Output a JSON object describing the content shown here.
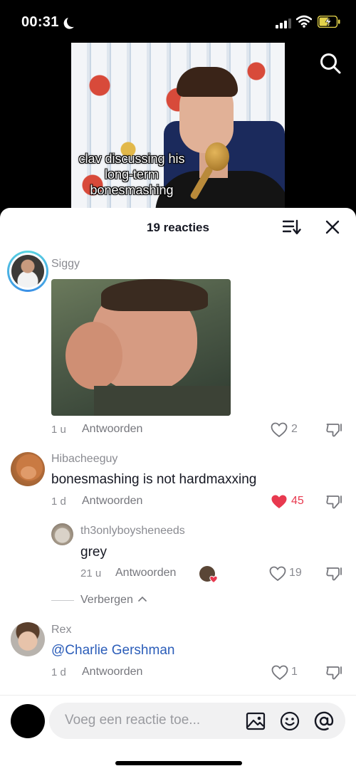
{
  "status_bar": {
    "time": "00:31"
  },
  "video": {
    "caption": "clav discussing his long-term bonesmashing"
  },
  "comments_header": {
    "title": "19 reacties"
  },
  "comments": [
    {
      "username": "Siggy",
      "text": "",
      "time": "1 u",
      "reply": "Antwoorden",
      "likes": "2",
      "liked": false
    },
    {
      "username": "Hibacheeguy",
      "text": "bonesmashing is not hardmaxxing",
      "time": "1 d",
      "reply": "Antwoorden",
      "likes": "45",
      "liked": true
    },
    {
      "username": "th3onlyboysheneeds",
      "text": "grey",
      "time": "21 u",
      "reply": "Antwoorden",
      "likes": "19",
      "liked": false
    },
    {
      "username": "Rex",
      "mention": "@Charlie Gershman",
      "time": "1 d",
      "reply": "Antwoorden",
      "likes": "1",
      "liked": false
    }
  ],
  "hide_replies": "Verbergen",
  "input": {
    "placeholder": "Voeg een reactie toe..."
  },
  "colors": {
    "like_active": "#e8394f",
    "mention": "#2b5db9",
    "sheet_bg": "#ffffff"
  }
}
